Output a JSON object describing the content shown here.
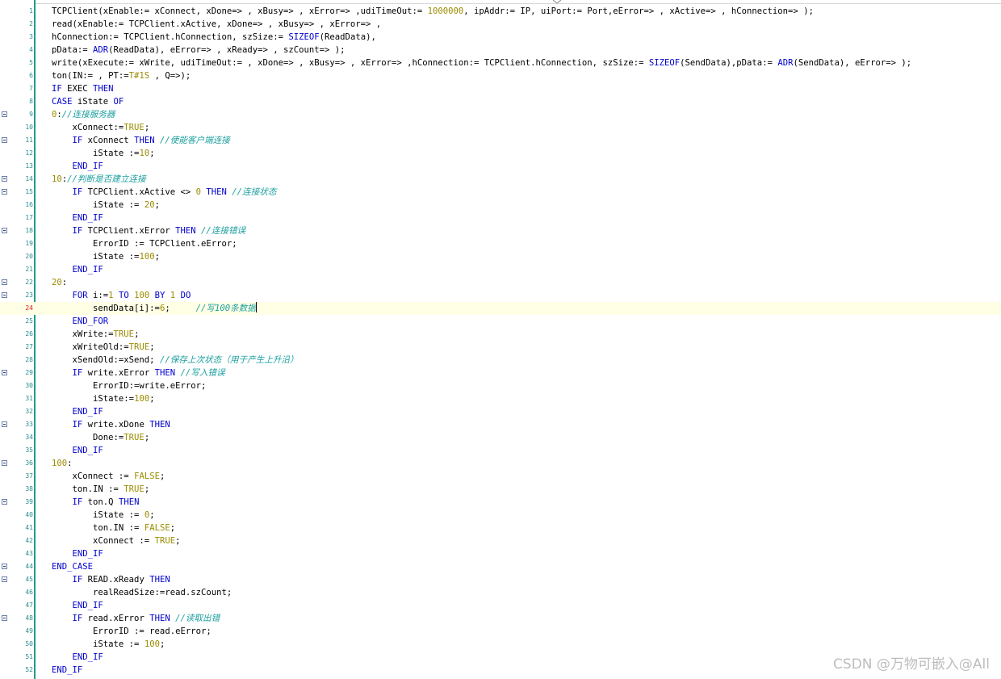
{
  "editor": {
    "watermark": "CSDN @万物可嵌入@All",
    "current_line": 24,
    "lines": [
      {
        "n": "1",
        "fold": false,
        "tokens": [
          [
            "TCPClient(xEnable:= xConnect, xDone=> , xBusy=> , xError=> ,udiTimeOut:= ",
            "plain"
          ],
          [
            "1000000",
            "num"
          ],
          [
            ", ipAddr:= IP, uiPort:= Port,eError=> , xActive=> , hConnection=> );",
            "plain"
          ]
        ]
      },
      {
        "n": "2",
        "fold": false,
        "tokens": [
          [
            "read(xEnable:= TCPClient.xActive, xDone=> , xBusy=> , xError=> ,",
            "plain"
          ]
        ]
      },
      {
        "n": "3",
        "fold": false,
        "tokens": [
          [
            "hConnection:= TCPClient.hConnection, szSize:= ",
            "plain"
          ],
          [
            "SIZEOF",
            "kw"
          ],
          [
            "(ReadData),",
            "plain"
          ]
        ]
      },
      {
        "n": "4",
        "fold": false,
        "tokens": [
          [
            "pData:= ",
            "plain"
          ],
          [
            "ADR",
            "kw"
          ],
          [
            "(ReadData), eError=> , xReady=> , szCount=> );",
            "plain"
          ]
        ]
      },
      {
        "n": "5",
        "fold": false,
        "tokens": [
          [
            "write(xExecute:= xWrite, udiTimeOut:= , xDone=> , xBusy=> , xError=> ,hConnection:= TCPClient.hConnection, szSize:= ",
            "plain"
          ],
          [
            "SIZEOF",
            "kw"
          ],
          [
            "(SendData),pData:= ",
            "plain"
          ],
          [
            "ADR",
            "kw"
          ],
          [
            "(SendData), eError=> );",
            "plain"
          ]
        ]
      },
      {
        "n": "6",
        "fold": false,
        "tokens": [
          [
            "ton(IN:= , PT:=",
            "plain"
          ],
          [
            "T#1S",
            "num"
          ],
          [
            " , Q=>);",
            "plain"
          ]
        ]
      },
      {
        "n": "7",
        "fold": false,
        "tokens": [
          [
            "IF",
            "kw"
          ],
          [
            " EXEC ",
            "plain"
          ],
          [
            "THEN",
            "kw"
          ]
        ]
      },
      {
        "n": "8",
        "fold": false,
        "tokens": [
          [
            "CASE",
            "kw"
          ],
          [
            " iState ",
            "plain"
          ],
          [
            "OF",
            "kw"
          ]
        ]
      },
      {
        "n": "9",
        "fold": true,
        "tokens": [
          [
            "0",
            "num"
          ],
          [
            ":",
            "plain"
          ],
          [
            "//连接服务器",
            "cmt"
          ]
        ]
      },
      {
        "n": "10",
        "fold": false,
        "tokens": [
          [
            "    xConnect:=",
            "plain"
          ],
          [
            "TRUE",
            "num"
          ],
          [
            ";",
            "plain"
          ]
        ]
      },
      {
        "n": "11",
        "fold": true,
        "tokens": [
          [
            "    ",
            "plain"
          ],
          [
            "IF",
            "kw"
          ],
          [
            " xConnect ",
            "plain"
          ],
          [
            "THEN",
            "kw"
          ],
          [
            " ",
            "plain"
          ],
          [
            "//使能客户端连接",
            "cmt"
          ]
        ]
      },
      {
        "n": "12",
        "fold": false,
        "tokens": [
          [
            "        iState :=",
            "plain"
          ],
          [
            "10",
            "num"
          ],
          [
            ";",
            "plain"
          ]
        ]
      },
      {
        "n": "13",
        "fold": false,
        "tokens": [
          [
            "    ",
            "plain"
          ],
          [
            "END_IF",
            "kw"
          ]
        ]
      },
      {
        "n": "14",
        "fold": true,
        "tokens": [
          [
            "10",
            "num"
          ],
          [
            ":",
            "plain"
          ],
          [
            "//判断是否建立连接",
            "cmt"
          ]
        ]
      },
      {
        "n": "15",
        "fold": true,
        "tokens": [
          [
            "    ",
            "plain"
          ],
          [
            "IF",
            "kw"
          ],
          [
            " TCPClient.xActive <> ",
            "plain"
          ],
          [
            "0",
            "num"
          ],
          [
            " ",
            "plain"
          ],
          [
            "THEN",
            "kw"
          ],
          [
            " ",
            "plain"
          ],
          [
            "//连接状态",
            "cmt"
          ]
        ]
      },
      {
        "n": "16",
        "fold": false,
        "tokens": [
          [
            "        iState := ",
            "plain"
          ],
          [
            "20",
            "num"
          ],
          [
            ";",
            "plain"
          ]
        ]
      },
      {
        "n": "17",
        "fold": false,
        "tokens": [
          [
            "    ",
            "plain"
          ],
          [
            "END_IF",
            "kw"
          ]
        ]
      },
      {
        "n": "18",
        "fold": true,
        "tokens": [
          [
            "    ",
            "plain"
          ],
          [
            "IF",
            "kw"
          ],
          [
            " TCPClient.xError ",
            "plain"
          ],
          [
            "THEN",
            "kw"
          ],
          [
            " ",
            "plain"
          ],
          [
            "//连接错误",
            "cmt"
          ]
        ]
      },
      {
        "n": "19",
        "fold": false,
        "tokens": [
          [
            "        ErrorID := TCPClient.eError;",
            "plain"
          ]
        ]
      },
      {
        "n": "20",
        "fold": false,
        "tokens": [
          [
            "        iState :=",
            "plain"
          ],
          [
            "100",
            "num"
          ],
          [
            ";",
            "plain"
          ]
        ]
      },
      {
        "n": "21",
        "fold": false,
        "tokens": [
          [
            "    ",
            "plain"
          ],
          [
            "END_IF",
            "kw"
          ]
        ]
      },
      {
        "n": "22",
        "fold": true,
        "tokens": [
          [
            "20",
            "num"
          ],
          [
            ":",
            "plain"
          ]
        ]
      },
      {
        "n": "23",
        "fold": true,
        "tokens": [
          [
            "    ",
            "plain"
          ],
          [
            "FOR",
            "kw"
          ],
          [
            " i:=",
            "plain"
          ],
          [
            "1",
            "num"
          ],
          [
            " ",
            "plain"
          ],
          [
            "TO",
            "kw"
          ],
          [
            " ",
            "plain"
          ],
          [
            "100",
            "num"
          ],
          [
            " ",
            "plain"
          ],
          [
            "BY",
            "kw"
          ],
          [
            " ",
            "plain"
          ],
          [
            "1",
            "num"
          ],
          [
            " ",
            "plain"
          ],
          [
            "DO",
            "kw"
          ]
        ]
      },
      {
        "n": "24",
        "fold": false,
        "tokens": [
          [
            "        sendData[i]:=",
            "plain"
          ],
          [
            "6",
            "num"
          ],
          [
            ";     ",
            "plain"
          ],
          [
            "//写100条数据",
            "cmt"
          ]
        ]
      },
      {
        "n": "25",
        "fold": false,
        "tokens": [
          [
            "    ",
            "plain"
          ],
          [
            "END_FOR",
            "kw"
          ]
        ]
      },
      {
        "n": "26",
        "fold": false,
        "tokens": [
          [
            "    xWrite:=",
            "plain"
          ],
          [
            "TRUE",
            "num"
          ],
          [
            ";",
            "plain"
          ]
        ]
      },
      {
        "n": "27",
        "fold": false,
        "tokens": [
          [
            "    xWriteOld:=",
            "plain"
          ],
          [
            "TRUE",
            "num"
          ],
          [
            ";",
            "plain"
          ]
        ]
      },
      {
        "n": "28",
        "fold": false,
        "tokens": [
          [
            "    xSendOld:=xSend; ",
            "plain"
          ],
          [
            "//保存上次状态（用于产生上升沿）",
            "cmt"
          ]
        ]
      },
      {
        "n": "29",
        "fold": true,
        "tokens": [
          [
            "    ",
            "plain"
          ],
          [
            "IF",
            "kw"
          ],
          [
            " write.xError ",
            "plain"
          ],
          [
            "THEN",
            "kw"
          ],
          [
            " ",
            "plain"
          ],
          [
            "//写入错误",
            "cmt"
          ]
        ]
      },
      {
        "n": "30",
        "fold": false,
        "tokens": [
          [
            "        ErrorID:=write.eError;",
            "plain"
          ]
        ]
      },
      {
        "n": "31",
        "fold": false,
        "tokens": [
          [
            "        iState:=",
            "plain"
          ],
          [
            "100",
            "num"
          ],
          [
            ";",
            "plain"
          ]
        ]
      },
      {
        "n": "32",
        "fold": false,
        "tokens": [
          [
            "    ",
            "plain"
          ],
          [
            "END_IF",
            "kw"
          ]
        ]
      },
      {
        "n": "33",
        "fold": true,
        "tokens": [
          [
            "    ",
            "plain"
          ],
          [
            "IF",
            "kw"
          ],
          [
            " write.xDone ",
            "plain"
          ],
          [
            "THEN",
            "kw"
          ]
        ]
      },
      {
        "n": "34",
        "fold": false,
        "tokens": [
          [
            "        Done:=",
            "plain"
          ],
          [
            "TRUE",
            "num"
          ],
          [
            ";",
            "plain"
          ]
        ]
      },
      {
        "n": "35",
        "fold": false,
        "tokens": [
          [
            "    ",
            "plain"
          ],
          [
            "END_IF",
            "kw"
          ]
        ]
      },
      {
        "n": "36",
        "fold": true,
        "tokens": [
          [
            "100",
            "num"
          ],
          [
            ":",
            "plain"
          ]
        ]
      },
      {
        "n": "37",
        "fold": false,
        "tokens": [
          [
            "    xConnect := ",
            "plain"
          ],
          [
            "FALSE",
            "num"
          ],
          [
            ";",
            "plain"
          ]
        ]
      },
      {
        "n": "38",
        "fold": false,
        "tokens": [
          [
            "    ton.IN := ",
            "plain"
          ],
          [
            "TRUE",
            "num"
          ],
          [
            ";",
            "plain"
          ]
        ]
      },
      {
        "n": "39",
        "fold": true,
        "tokens": [
          [
            "    ",
            "plain"
          ],
          [
            "IF",
            "kw"
          ],
          [
            " ton.Q ",
            "plain"
          ],
          [
            "THEN",
            "kw"
          ]
        ]
      },
      {
        "n": "40",
        "fold": false,
        "tokens": [
          [
            "        iState := ",
            "plain"
          ],
          [
            "0",
            "num"
          ],
          [
            ";",
            "plain"
          ]
        ]
      },
      {
        "n": "41",
        "fold": false,
        "tokens": [
          [
            "        ton.IN := ",
            "plain"
          ],
          [
            "FALSE",
            "num"
          ],
          [
            ";",
            "plain"
          ]
        ]
      },
      {
        "n": "42",
        "fold": false,
        "tokens": [
          [
            "        xConnect := ",
            "plain"
          ],
          [
            "TRUE",
            "num"
          ],
          [
            ";",
            "plain"
          ]
        ]
      },
      {
        "n": "43",
        "fold": false,
        "tokens": [
          [
            "    ",
            "plain"
          ],
          [
            "END_IF",
            "kw"
          ]
        ]
      },
      {
        "n": "44",
        "fold": true,
        "tokens": [
          [
            "END_CASE",
            "kw"
          ]
        ]
      },
      {
        "n": "45",
        "fold": true,
        "tokens": [
          [
            "    ",
            "plain"
          ],
          [
            "IF",
            "kw"
          ],
          [
            " READ.xReady ",
            "plain"
          ],
          [
            "THEN",
            "kw"
          ]
        ]
      },
      {
        "n": "46",
        "fold": false,
        "tokens": [
          [
            "        realReadSize:=read.szCount;",
            "plain"
          ]
        ]
      },
      {
        "n": "47",
        "fold": false,
        "tokens": [
          [
            "    ",
            "plain"
          ],
          [
            "END_IF",
            "kw"
          ]
        ]
      },
      {
        "n": "48",
        "fold": true,
        "tokens": [
          [
            "    ",
            "plain"
          ],
          [
            "IF",
            "kw"
          ],
          [
            " read.xError ",
            "plain"
          ],
          [
            "THEN",
            "kw"
          ],
          [
            " ",
            "plain"
          ],
          [
            "//读取出错",
            "cmt"
          ]
        ]
      },
      {
        "n": "49",
        "fold": false,
        "tokens": [
          [
            "        ErrorID := read.eError;",
            "plain"
          ]
        ]
      },
      {
        "n": "50",
        "fold": false,
        "tokens": [
          [
            "        iState := ",
            "plain"
          ],
          [
            "100",
            "num"
          ],
          [
            ";",
            "plain"
          ]
        ]
      },
      {
        "n": "51",
        "fold": false,
        "tokens": [
          [
            "    ",
            "plain"
          ],
          [
            "END_IF",
            "kw"
          ]
        ]
      },
      {
        "n": "52",
        "fold": false,
        "tokens": [
          [
            "END_IF",
            "kw"
          ]
        ]
      }
    ]
  }
}
